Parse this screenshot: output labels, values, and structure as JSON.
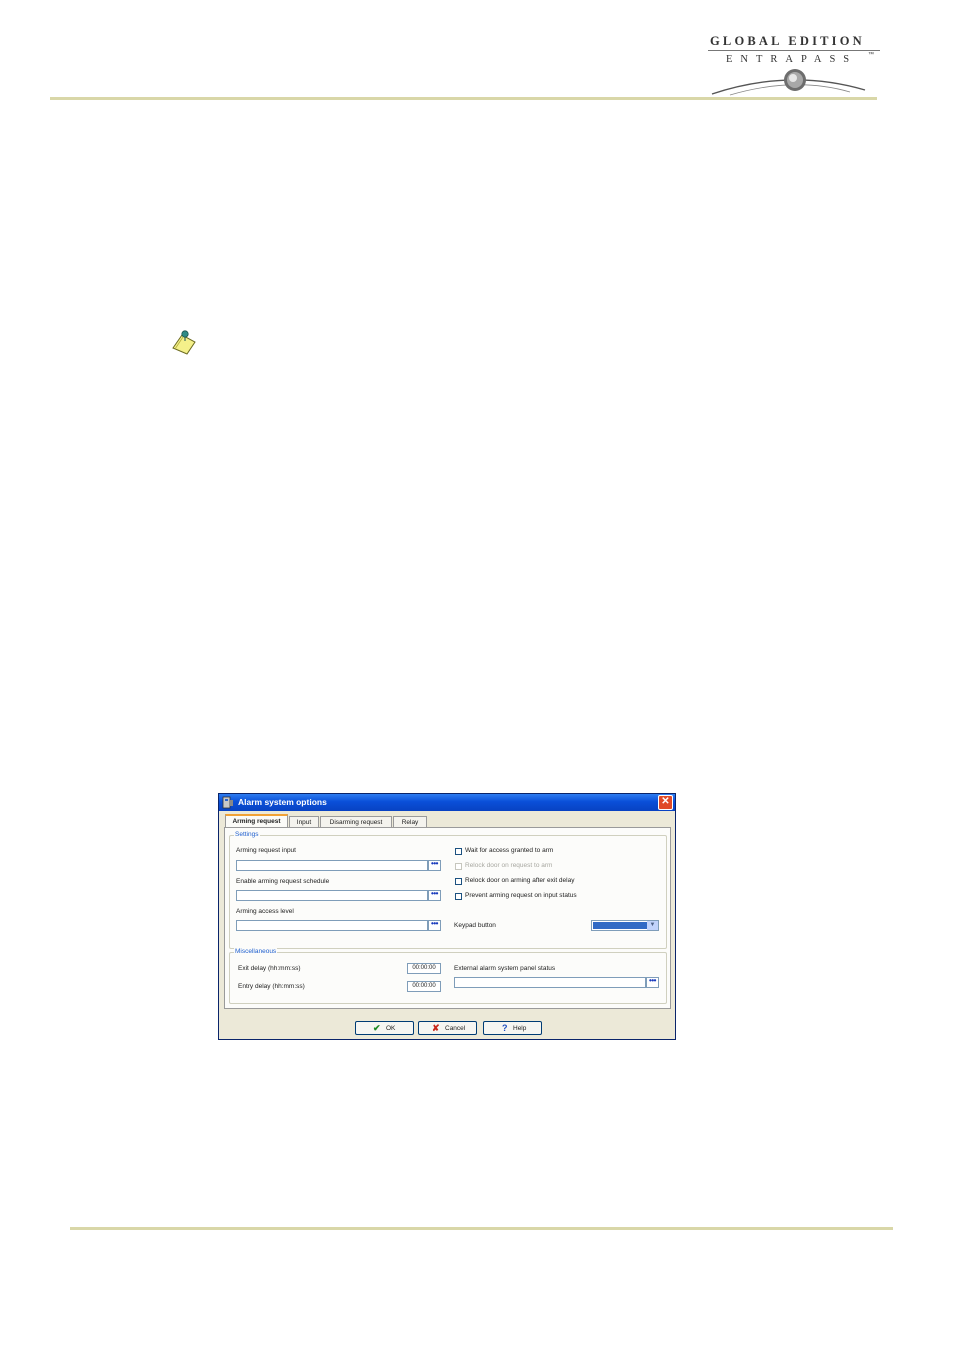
{
  "header": {
    "logo_line1": "GLOBAL EDITION",
    "logo_line2": "ENTRAPASS",
    "logo_tm": "™"
  },
  "dialog": {
    "title": "Alarm system options",
    "close": "✕",
    "tabs": [
      "Arming request",
      "Input",
      "Disarming request",
      "Relay"
    ],
    "active_tab": "Arming request",
    "settings": {
      "legend": "Settings",
      "arming_request_input_label": "Arming request input",
      "arming_request_input_value": "",
      "enable_schedule_label": "Enable arming request schedule",
      "enable_schedule_value": "",
      "arming_access_level_label": "Arming access level",
      "arming_access_level_value": "",
      "browse": "•••",
      "checkboxes": [
        {
          "label": "Wait for access granted to arm",
          "checked": false,
          "enabled": true
        },
        {
          "label": "Relock door on request to arm",
          "checked": false,
          "enabled": false
        },
        {
          "label": "Relock door on arming after exit delay",
          "checked": false,
          "enabled": true
        },
        {
          "label": "Prevent arming request on input status",
          "checked": false,
          "enabled": true
        }
      ],
      "keypad_button_label": "Keypad button",
      "keypad_button_value": ""
    },
    "miscellaneous": {
      "legend": "Miscellaneous",
      "exit_delay_label": "Exit delay (hh:mm:ss)",
      "exit_delay_value": "00:00:00",
      "entry_delay_label": "Entry delay (hh:mm:ss)",
      "entry_delay_value": "00:00:00",
      "panel_status_label": "External alarm system panel status",
      "panel_status_value": ""
    },
    "buttons": {
      "ok": "OK",
      "cancel": "Cancel",
      "help": "Help"
    }
  },
  "colors": {
    "rule": "#d9d7a8",
    "title_bar": "#0a4fd8",
    "dialog_bg": "#ece9d8",
    "legend": "#1f5fce",
    "selection": "#316ac5"
  }
}
